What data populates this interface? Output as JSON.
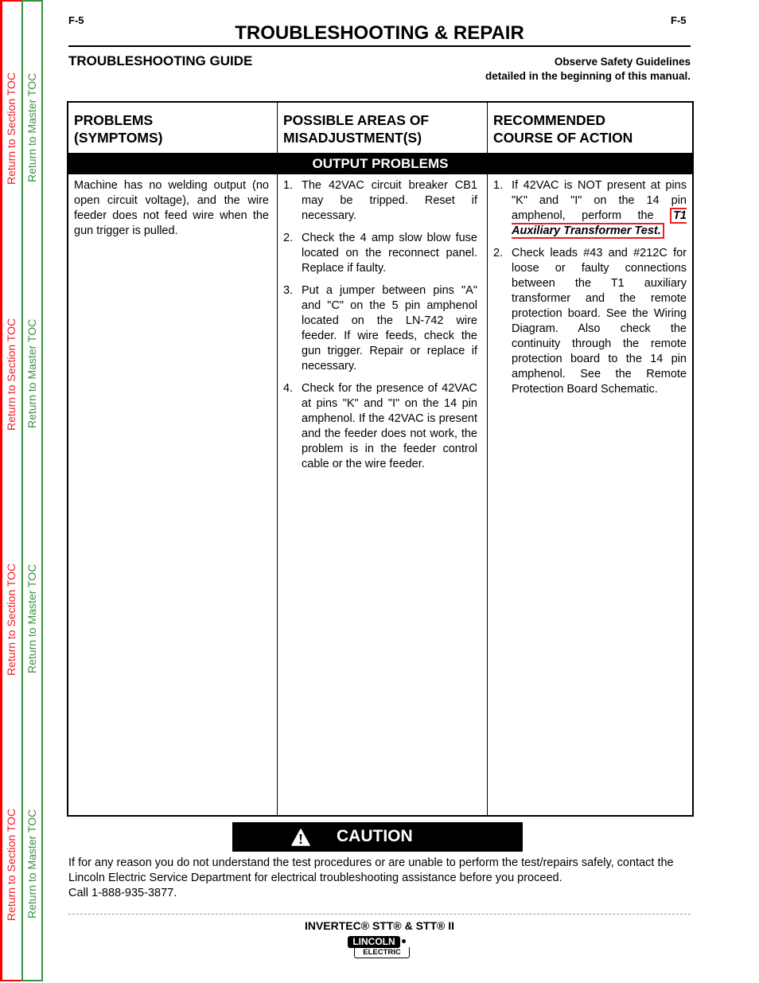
{
  "sidebar": {
    "section_toc_label": "Return to Section TOC",
    "master_toc_label": "Return to Master TOC",
    "colors": {
      "section": "#ee1c24",
      "master": "#3a9140"
    }
  },
  "header": {
    "page_number_left": "F-5",
    "page_number_right": "F-5",
    "title": "TROUBLESHOOTING & REPAIR",
    "guide_title": "TROUBLESHOOTING GUIDE",
    "safety_note_line1": "Observe Safety Guidelines",
    "safety_note_line2": "detailed in the beginning of this manual."
  },
  "table": {
    "columns": [
      {
        "line1": "PROBLEMS",
        "line2": "(SYMPTOMS)"
      },
      {
        "line1": "POSSIBLE AREAS OF",
        "line2": "MISADJUSTMENT(S)"
      },
      {
        "line1": "RECOMMENDED",
        "line2": "COURSE OF ACTION"
      }
    ],
    "section_title": "OUTPUT PROBLEMS",
    "rows": [
      {
        "symptom": "Machine has no welding output (no open circuit voltage), and the wire feeder does not feed wire when the gun trigger is pulled.",
        "misadjustments": [
          {
            "num": "1.",
            "text": "The 42VAC circuit breaker CB1 may be tripped.  Reset if necessary."
          },
          {
            "num": "2.",
            "text": "Check the 4 amp slow blow fuse located on the reconnect panel. Replace if faulty."
          },
          {
            "num": "3.",
            "text": "Put a jumper between pins \"A\" and \"C\" on the 5 pin amphenol located on the LN-742 wire feeder.  If wire feeds, check the gun trigger.  Repair or replace if necessary."
          },
          {
            "num": "4.",
            "text": "Check for the presence of 42VAC at pins \"K\" and \"I\" on the 14 pin amphenol.  If the 42VAC is present and the feeder does not work, the problem is in the feeder control cable or the wire feeder."
          }
        ],
        "actions": [
          {
            "num": "1.",
            "text": "If 42VAC is NOT present at pins \"K\" and \"I\" on the 14 pin amphenol, perform the ",
            "link": "T1 Auxiliary Transformer Test."
          },
          {
            "num": "2.",
            "text": "Check leads #43 and #212C for loose or faulty connections between the T1 auxiliary transformer and the remote protection board.  See the Wiring Diagram.  Also check the continuity through the remote protection board to the 14 pin amphenol.  See the Remote Protection Board Schematic."
          }
        ]
      }
    ]
  },
  "caution": {
    "icon": "warning-triangle-icon",
    "label": "CAUTION",
    "text_line1": "If for any reason you do not understand the test procedures or are unable to perform the test/repairs safely, contact the Lincoln Electric Service Department for electrical troubleshooting assistance before you proceed.",
    "text_line2": "Call 1-888-935-3877."
  },
  "footer": {
    "product": "INVERTEC® STT® & STT® II",
    "logo_top": "LINCOLN",
    "logo_bottom": "ELECTRIC"
  }
}
